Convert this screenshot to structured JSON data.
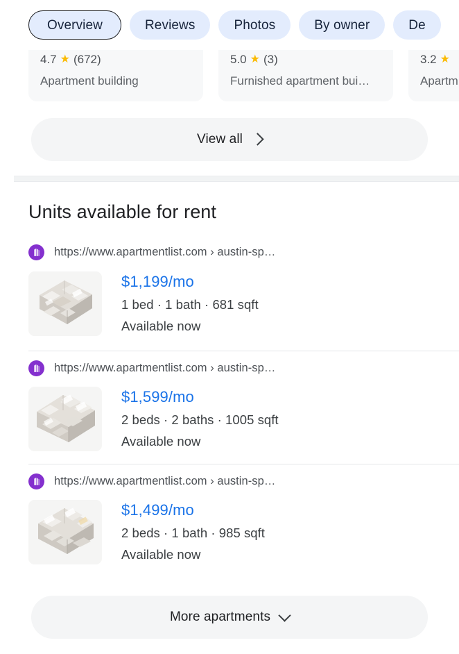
{
  "tabs": [
    {
      "label": "Overview",
      "selected": true
    },
    {
      "label": "Reviews",
      "selected": false
    },
    {
      "label": "Photos",
      "selected": false
    },
    {
      "label": "By owner",
      "selected": false
    },
    {
      "label": "De",
      "selected": false
    }
  ],
  "place_cards": [
    {
      "rating": "4.7",
      "star": "★",
      "reviews": "(672)",
      "type": "Apartment building"
    },
    {
      "rating": "5.0",
      "star": "★",
      "reviews": "(3)",
      "type": "Furnished apartment bui…"
    },
    {
      "rating": "3.2",
      "star": "★",
      "reviews": "",
      "type": "Apartm"
    }
  ],
  "view_all": {
    "label": "View all",
    "icon": "chevron-right-icon"
  },
  "section": {
    "title": "Units available for rent"
  },
  "listings": [
    {
      "url": "https://www.apartmentlist.com › austin-sp…",
      "favicon": "apartmentlist-icon",
      "price": "$1,199/mo",
      "specs": "1 bed · 1 bath · 681 sqft",
      "availability": "Available now",
      "thumbnail": "floor-plan-1-bed"
    },
    {
      "url": "https://www.apartmentlist.com › austin-sp…",
      "favicon": "apartmentlist-icon",
      "price": "$1,599/mo",
      "specs": "2 beds · 2 baths · 1005 sqft",
      "availability": "Available now",
      "thumbnail": "floor-plan-2-bed-2-bath"
    },
    {
      "url": "https://www.apartmentlist.com › austin-sp…",
      "favicon": "apartmentlist-icon",
      "price": "$1,499/mo",
      "specs": "2 beds · 1 bath · 985 sqft",
      "availability": "Available now",
      "thumbnail": "floor-plan-2-bed-1-bath"
    }
  ],
  "more_apartments": {
    "label": "More apartments",
    "icon": "chevron-down-icon"
  },
  "colors": {
    "chip_background": "#e3ecfd",
    "chip_selected_border": "#202124",
    "price_link": "#1a73e8",
    "star": "#fabb05",
    "favicon_purple": "#8430ce",
    "button_background": "#f4f5f6",
    "card_background": "#f7f8f9",
    "separator": "#f1f3f4"
  }
}
